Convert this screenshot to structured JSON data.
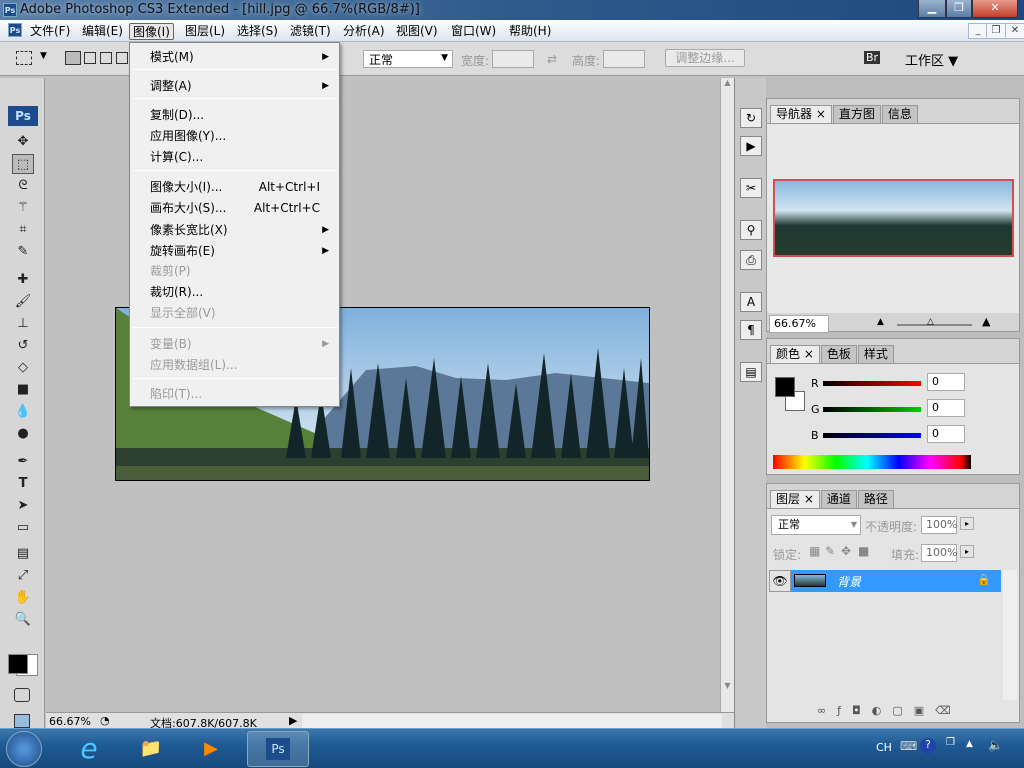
{
  "window": {
    "title": "Adobe Photoshop CS3 Extended - [hill.jpg @ 66.7%(RGB/8#)]",
    "app_icon": "Ps"
  },
  "menubar": {
    "items": [
      "文件(F)",
      "编辑(E)",
      "图像(I)",
      "图层(L)",
      "选择(S)",
      "滤镜(T)",
      "分析(A)",
      "视图(V)",
      "窗口(W)",
      "帮助(H)"
    ],
    "active": "图像(I)"
  },
  "options": {
    "mode": "正常",
    "width_label": "宽度:",
    "height_label": "高度:",
    "refine_edge": "调整边缘...",
    "workspace": "工作区"
  },
  "image_menu": {
    "items": [
      {
        "label": "模式(M)",
        "submenu": true
      },
      {
        "label": "调整(A)",
        "submenu": true
      },
      {
        "label": "复制(D)..."
      },
      {
        "label": "应用图像(Y)..."
      },
      {
        "label": "计算(C)..."
      },
      {
        "label": "图像大小(I)...",
        "shortcut": "Alt+Ctrl+I"
      },
      {
        "label": "画布大小(S)...",
        "shortcut": "Alt+Ctrl+C"
      },
      {
        "label": "像素长宽比(X)",
        "submenu": true
      },
      {
        "label": "旋转画布(E)",
        "submenu": true
      },
      {
        "label": "裁剪(P)",
        "disabled": true
      },
      {
        "label": "裁切(R)..."
      },
      {
        "label": "显示全部(V)",
        "disabled": true
      },
      {
        "label": "变量(B)",
        "submenu": true,
        "disabled": true
      },
      {
        "label": "应用数据组(L)...",
        "disabled": true
      },
      {
        "label": "陷印(T)...",
        "disabled": true
      }
    ]
  },
  "navigator": {
    "tabs": [
      "导航器",
      "直方图",
      "信息"
    ],
    "zoom": "66.67%"
  },
  "color": {
    "tabs": [
      "颜色",
      "色板",
      "样式"
    ],
    "r_label": "R",
    "g_label": "G",
    "b_label": "B",
    "r": "0",
    "g": "0",
    "b": "0",
    "foreground": "#000000",
    "background": "#ffffff"
  },
  "layers": {
    "tabs": [
      "图层",
      "通道",
      "路径"
    ],
    "blend": "正常",
    "opacity_label": "不透明度:",
    "opacity": "100%",
    "lock_label": "锁定:",
    "fill_label": "填充:",
    "fill": "100%",
    "layer_name": "背景"
  },
  "status": {
    "zoom": "66.67%",
    "doc": "文档:607.8K/607.8K"
  },
  "taskbar": {
    "lang": "CH",
    "ps": "Ps"
  }
}
